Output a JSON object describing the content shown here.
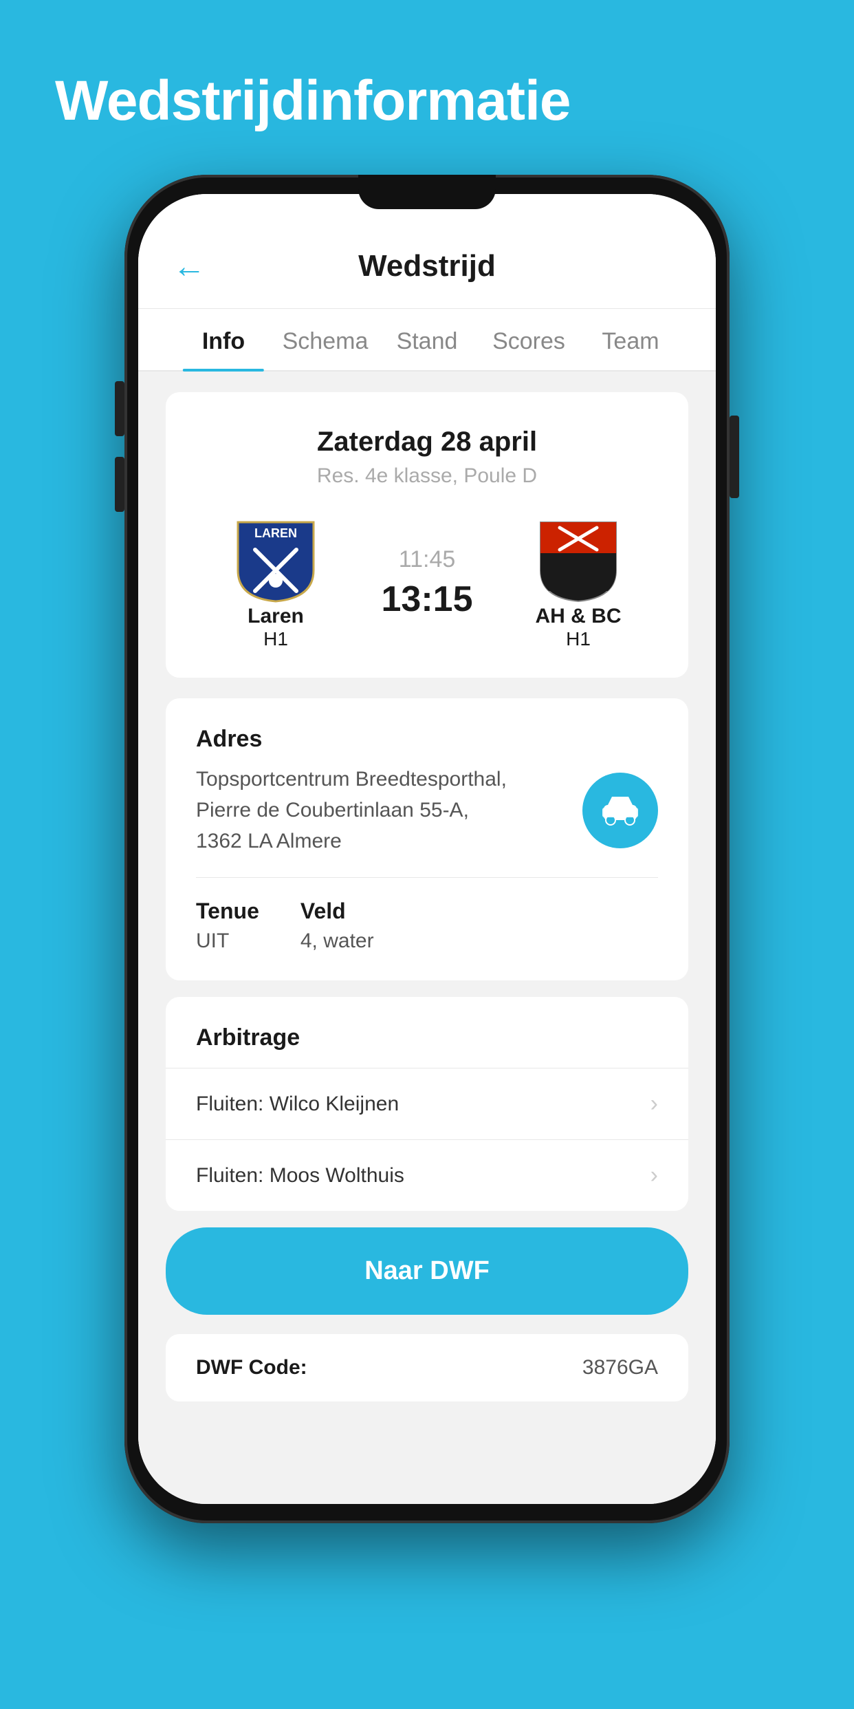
{
  "page": {
    "bg_title": "Wedstrijdinformatie",
    "header": {
      "back_label": "←",
      "title": "Wedstrijd"
    },
    "tabs": [
      {
        "id": "info",
        "label": "Info",
        "active": true
      },
      {
        "id": "schema",
        "label": "Schema",
        "active": false
      },
      {
        "id": "stand",
        "label": "Stand",
        "active": false
      },
      {
        "id": "scores",
        "label": "Scores",
        "active": false
      },
      {
        "id": "team",
        "label": "Team",
        "active": false
      }
    ],
    "match": {
      "date": "Zaterdag 28 april",
      "league": "Res. 4e klasse, Poule D",
      "home_team": {
        "name": "Laren",
        "sub": "H1"
      },
      "away_team": {
        "name": "AH & BC",
        "sub": "H1"
      },
      "time_scheduled": "11:45",
      "time_actual": "13:15"
    },
    "address": {
      "label": "Adres",
      "text_line1": "Topsportcentrum Breedtesporthal,",
      "text_line2": "Pierre de Coubertinlaan 55-A,",
      "text_line3": "1362 LA Almere"
    },
    "tenue": {
      "label": "Tenue",
      "value": "UIT"
    },
    "veld": {
      "label": "Veld",
      "value": "4, water"
    },
    "arbitrage": {
      "label": "Arbitrage",
      "items": [
        {
          "text": "Fluiten: Wilco Kleijnen"
        },
        {
          "text": "Fluiten: Moos Wolthuis"
        }
      ]
    },
    "dwf_button": "Naar DWF",
    "dwf_code": {
      "label": "DWF Code:",
      "value": "3876GA"
    },
    "colors": {
      "accent": "#29b8e0",
      "bg": "#29b8e0"
    }
  }
}
